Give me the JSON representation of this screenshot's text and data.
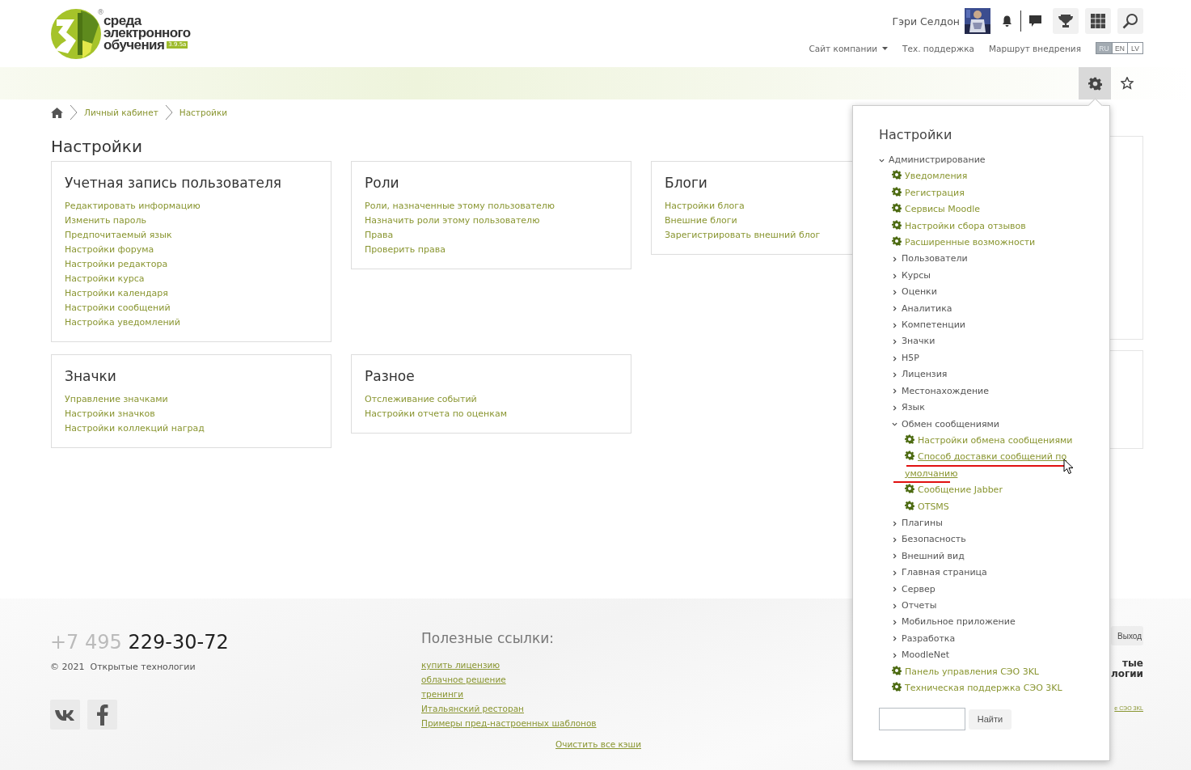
{
  "logo": {
    "mark": "®",
    "lines": [
      "среда",
      "электронного",
      "обучения"
    ],
    "version": "3.9.5a"
  },
  "user": {
    "name": "Гэри Селдон"
  },
  "top_links": [
    {
      "label": "Сайт компании",
      "dropdown": true
    },
    {
      "label": "Тех. поддержка",
      "dropdown": false
    },
    {
      "label": "Маршрут внедрения",
      "dropdown": false
    }
  ],
  "languages": [
    {
      "label": "RU",
      "selected": true
    },
    {
      "label": "EN",
      "selected": false
    },
    {
      "label": "LV",
      "selected": false
    }
  ],
  "breadcrumb": [
    "Личный кабинет",
    "Настройки"
  ],
  "page_title": "Настройки",
  "cards": [
    {
      "title": "Учетная запись пользователя",
      "links": [
        "Редактировать информацию",
        "Изменить пароль",
        "Предпочитаемый язык",
        "Настройки форума",
        "Настройки редактора",
        "Настройки курса",
        "Настройки календаря",
        "Настройки сообщений",
        "Настройка уведомлений"
      ]
    },
    {
      "title": "Роли",
      "links": [
        "Роли, назначенные этому пользователю",
        "Назначить роли этому пользователю",
        "Права",
        "Проверить права"
      ]
    },
    {
      "title": "Блоги",
      "links": [
        "Настройки блога",
        "Внешние блоги",
        "Зарегистрировать внешний блог"
      ]
    },
    {
      "title": "Значки",
      "links": [
        "Управление значками",
        "Настройки значков",
        "Настройки коллекций наград"
      ]
    },
    {
      "title": "Разное",
      "links": [
        "Отслеживание событий",
        "Настройки отчета по оценкам"
      ]
    }
  ],
  "settings_menu": {
    "title": "Настройки",
    "tree": [
      {
        "label": "Администрирование",
        "kind": "folder",
        "expanded": true,
        "children": [
          {
            "label": "Уведомления",
            "kind": "page"
          },
          {
            "label": "Регистрация",
            "kind": "page"
          },
          {
            "label": "Сервисы Moodle",
            "kind": "page"
          },
          {
            "label": "Настройки сбора отзывов",
            "kind": "page"
          },
          {
            "label": "Расширенные возможности",
            "kind": "page"
          },
          {
            "label": "Пользователи",
            "kind": "folder",
            "expanded": false
          },
          {
            "label": "Курсы",
            "kind": "folder",
            "expanded": false
          },
          {
            "label": "Оценки",
            "kind": "folder",
            "expanded": false
          },
          {
            "label": "Аналитика",
            "kind": "folder",
            "expanded": false
          },
          {
            "label": "Компетенции",
            "kind": "folder",
            "expanded": false
          },
          {
            "label": "Значки",
            "kind": "folder",
            "expanded": false
          },
          {
            "label": "H5P",
            "kind": "folder",
            "expanded": false
          },
          {
            "label": "Лицензия",
            "kind": "folder",
            "expanded": false
          },
          {
            "label": "Местонахождение",
            "kind": "folder",
            "expanded": false
          },
          {
            "label": "Язык",
            "kind": "folder",
            "expanded": false
          },
          {
            "label": "Обмен сообщениями",
            "kind": "folder",
            "expanded": true,
            "children": [
              {
                "label": "Настройки обмена сообщениями",
                "kind": "page"
              },
              {
                "label": "Способ доставки сообщений по умолчанию",
                "kind": "page",
                "highlighted": true
              },
              {
                "label": "Сообщение Jabber",
                "kind": "page"
              },
              {
                "label": "OTSMS",
                "kind": "page"
              }
            ]
          },
          {
            "label": "Плагины",
            "kind": "folder",
            "expanded": false
          },
          {
            "label": "Безопасность",
            "kind": "folder",
            "expanded": false
          },
          {
            "label": "Внешний вид",
            "kind": "folder",
            "expanded": false
          },
          {
            "label": "Главная страница",
            "kind": "folder",
            "expanded": false
          },
          {
            "label": "Сервер",
            "kind": "folder",
            "expanded": false
          },
          {
            "label": "Отчеты",
            "kind": "folder",
            "expanded": false
          },
          {
            "label": "Мобильное приложение",
            "kind": "folder",
            "expanded": false
          },
          {
            "label": "Разработка",
            "kind": "folder",
            "expanded": false
          },
          {
            "label": "MoodleNet",
            "kind": "folder",
            "expanded": false
          },
          {
            "label": "Панель управления СЭО 3KL",
            "kind": "page"
          },
          {
            "label": "Техническая поддержка СЭО 3KL",
            "kind": "page"
          }
        ]
      }
    ],
    "search": {
      "button": "Найти"
    }
  },
  "footer": {
    "phone_prefix": "+7 495",
    "phone": "229-30-72",
    "copyright": "© 2021  Открытые технологии",
    "links_title": "Полезные ссылки:",
    "links": [
      "купить лицензию",
      "облачное решение",
      "тренинги",
      "Итальянский ресторан",
      "Примеры пред-настроенных шаблонов"
    ],
    "clear_cache": "Очистить все кэши",
    "logout": "Выход",
    "company_fragment": [
      "тые",
      "логии"
    ],
    "link_fragment": "е СЭО 3KL"
  }
}
